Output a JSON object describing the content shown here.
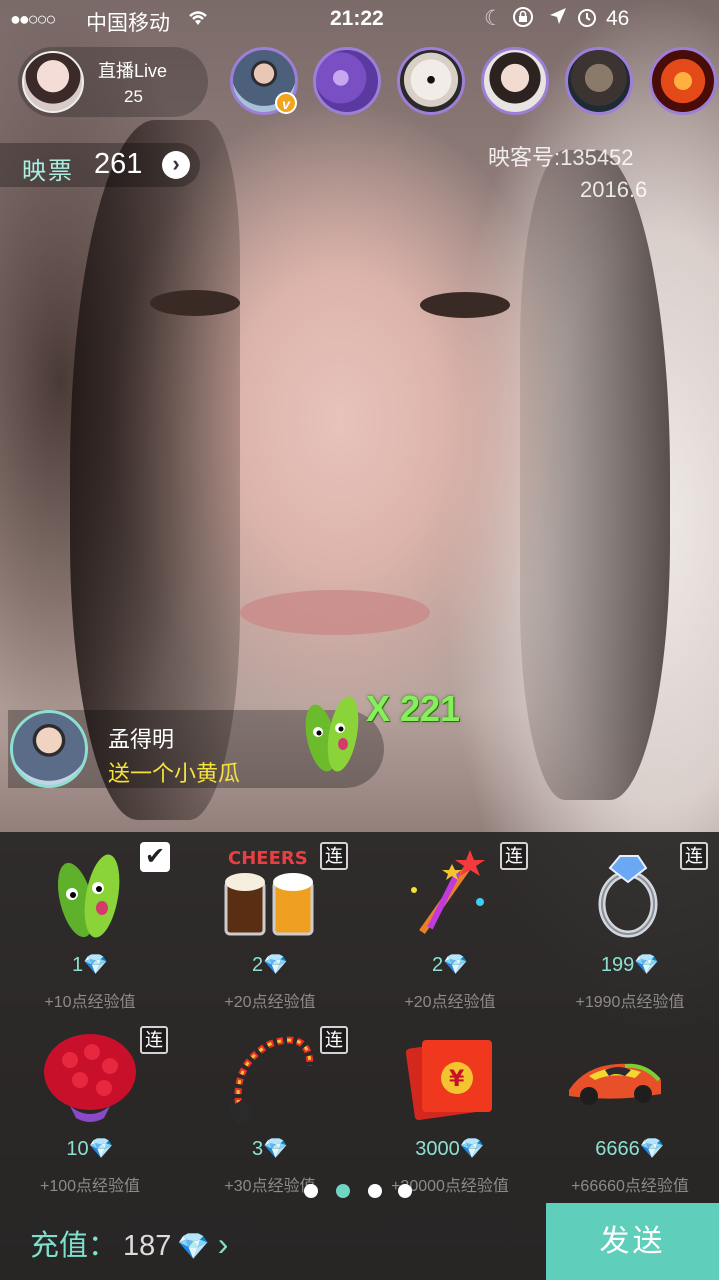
{
  "status_bar": {
    "signal": "●●○○○",
    "carrier": "中国移动",
    "time": "21:22",
    "battery": "46"
  },
  "host": {
    "title": "直播Live",
    "viewer_count": "25"
  },
  "viewers": [
    {
      "name": "viewer-1",
      "badge": "v"
    },
    {
      "name": "viewer-2"
    },
    {
      "name": "viewer-3"
    },
    {
      "name": "viewer-4"
    },
    {
      "name": "viewer-5"
    },
    {
      "name": "viewer-6"
    }
  ],
  "ticket": {
    "label": "映票",
    "value": "261",
    "arrow": "›"
  },
  "room_info": {
    "inke_id": "映客号:135452",
    "date": "2016.6"
  },
  "gift_message": {
    "sender": "孟得明",
    "text": "送一个小黄瓜",
    "combo": "X 221"
  },
  "gifts": [
    {
      "price": "1",
      "exp": "+10点经验值",
      "icon": "cucumber-icon",
      "selected": true
    },
    {
      "price": "2",
      "exp": "+20点经验值",
      "icon": "beer-cheers-icon",
      "tag": "连"
    },
    {
      "price": "2",
      "exp": "+20点经验值",
      "icon": "magic-wand-icon",
      "tag": "连"
    },
    {
      "price": "199",
      "exp": "+1990点经验值",
      "icon": "diamond-ring-icon",
      "tag": "连"
    },
    {
      "price": "10",
      "exp": "+100点经验值",
      "icon": "rose-bouquet-icon",
      "tag": "连"
    },
    {
      "price": "3",
      "exp": "+30点经验值",
      "icon": "whip-icon",
      "tag": "连"
    },
    {
      "price": "3000",
      "exp": "+30000点经验值",
      "icon": "red-envelope-icon"
    },
    {
      "price": "6666",
      "exp": "+66660点经验值",
      "icon": "sports-car-icon"
    }
  ],
  "gift_labels": {
    "diamond": "💎",
    "check": "✔"
  },
  "pager": {
    "count": 4,
    "active": 1
  },
  "footer": {
    "recharge_label": "充值：",
    "recharge_amount": "187",
    "diamond": "💎",
    "chevron": "›",
    "send_label": "发送"
  }
}
